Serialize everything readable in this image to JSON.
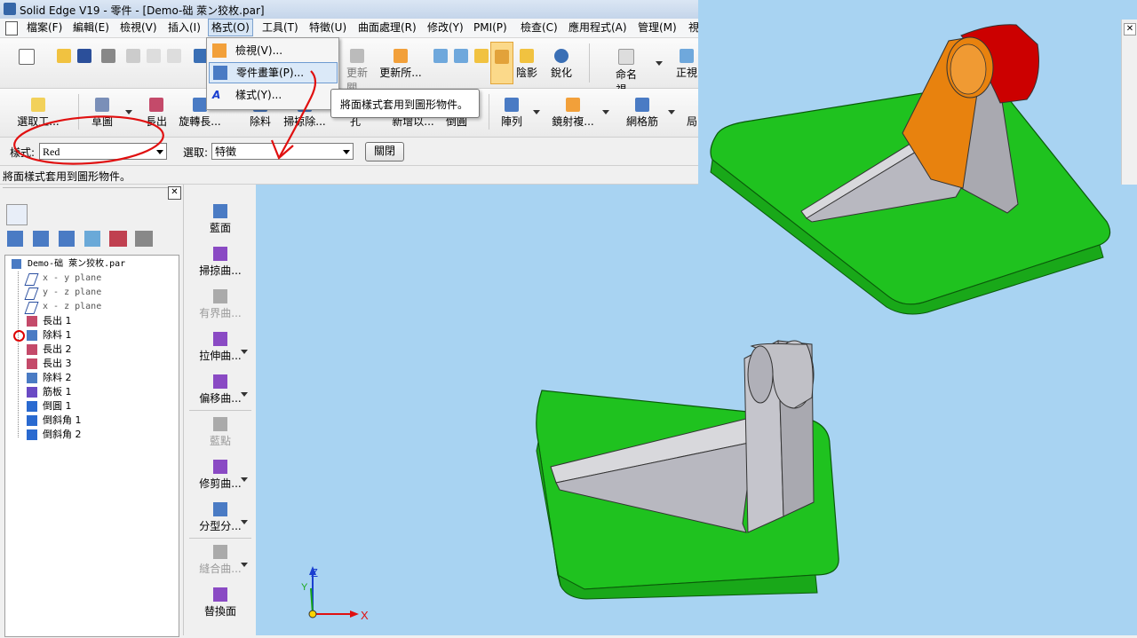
{
  "window": {
    "title": "Solid Edge V19 - 零件 - [Demo-础  萊ン狡枚.par]"
  },
  "menubar": [
    "檔案(F)",
    "編輯(E)",
    "檢視(V)",
    "插入(I)",
    "格式(O)",
    "工具(T)",
    "特徵(U)",
    "曲面處理(R)",
    "修改(Y)",
    "PMI(P)",
    "檢查(C)",
    "應用程式(A)",
    "管理(M)",
    "視"
  ],
  "format_menu": {
    "items": [
      "檢視(V)...",
      "零件畫筆(P)...",
      "樣式(Y)..."
    ]
  },
  "tooltip": "將面樣式套用到圖形物件。",
  "toolbar1": {
    "labels": [
      "更新關...",
      "更新所...",
      "陰影",
      "銳化",
      "命名視...",
      "正視"
    ]
  },
  "toolbar2": {
    "labels": [
      "選取工...",
      "草圖",
      "長出",
      "旋轉長...",
      "除料",
      "掃掠除...",
      "孔",
      "新增以...",
      "倒圓",
      "陣列",
      "鏡射複...",
      "網格筋",
      "局"
    ]
  },
  "stylebar": {
    "style_label": "樣式:",
    "style_value": "Red",
    "select_label": "選取:",
    "select_value": "特徵",
    "close_button": "關閉"
  },
  "statusbar": "將面樣式套用到圖形物件。",
  "tree": {
    "root": "Demo-础  萊ン狡枚.par",
    "items": [
      {
        "label": "x - y plane",
        "type": "plane"
      },
      {
        "label": "y - z plane",
        "type": "plane"
      },
      {
        "label": "x - z plane",
        "type": "plane"
      },
      {
        "label": "長出 1",
        "type": "feature"
      },
      {
        "label": "除料 1",
        "type": "feature"
      },
      {
        "label": "長出 2",
        "type": "feature"
      },
      {
        "label": "長出 3",
        "type": "feature"
      },
      {
        "label": "除料 2",
        "type": "feature"
      },
      {
        "label": "筋板 1",
        "type": "feature"
      },
      {
        "label": "倒圓 1",
        "type": "feature"
      },
      {
        "label": "倒斜角 1",
        "type": "feature"
      },
      {
        "label": "倒斜角 2",
        "type": "feature"
      }
    ]
  },
  "surfacing": {
    "items": [
      "藍面",
      "掃掠曲...",
      "有界曲...",
      "拉伸曲...",
      "偏移曲...",
      "藍點",
      "修剪曲...",
      "分型分...",
      "縫合曲...",
      "替換面"
    ]
  },
  "triad": {
    "z": "Z",
    "y": "Y",
    "x": "X"
  },
  "colors": {
    "viewport_bg": "#a8d3f2",
    "part_green": "#1fc21f",
    "bracket_orange": "#e8820e",
    "boss_red": "#cc0000",
    "part_grey": "#b8b8c0",
    "annotation_red": "#e01010"
  }
}
